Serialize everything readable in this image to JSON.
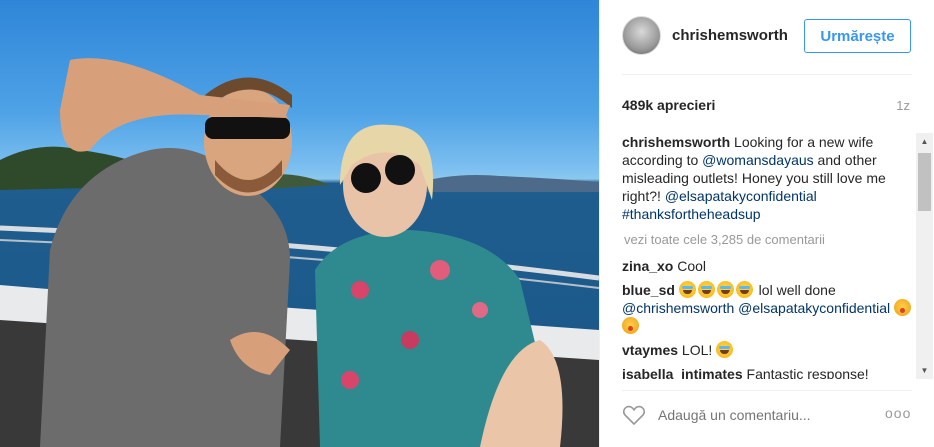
{
  "post": {
    "photo_alt": "photo"
  },
  "header": {
    "username": "chrishemsworth",
    "follow_label": "Urmărește"
  },
  "stats": {
    "likes": "489k aprecieri",
    "time": "1z"
  },
  "caption": {
    "user": "chrishemsworth",
    "text_1": " Looking for a new wife according to ",
    "mention_1": "@womansdayaus",
    "text_2": " and other misleading outlets! Honey you still love me right?! ",
    "mention_2": "@elsapatakyconfidential",
    "hashtag": "#thanksfortheheadsup"
  },
  "view_all": "vezi toate cele 3,285 de comentarii",
  "comments": [
    {
      "user": "zina_xo",
      "text": " Cool"
    },
    {
      "user": "blue_sd",
      "text": " lol well done ",
      "mention_1": "@chrishemsworth",
      "mention_2": "@elsapatakyconfidential"
    },
    {
      "user": "vtaymes",
      "text": " LOL! "
    },
    {
      "user": "isabella_intimates",
      "text": " Fantastic response!"
    }
  ],
  "footer": {
    "comment_placeholder": "Adaugă un comentariu...",
    "more_label": "ooo"
  },
  "icons": {
    "heart": "heart-icon",
    "more": "more-options-icon",
    "scroll_up": "scroll-up-icon",
    "scroll_down": "scroll-down-icon"
  },
  "colors": {
    "accent": "#3897f0",
    "mention": "#003569",
    "muted": "#999999"
  }
}
